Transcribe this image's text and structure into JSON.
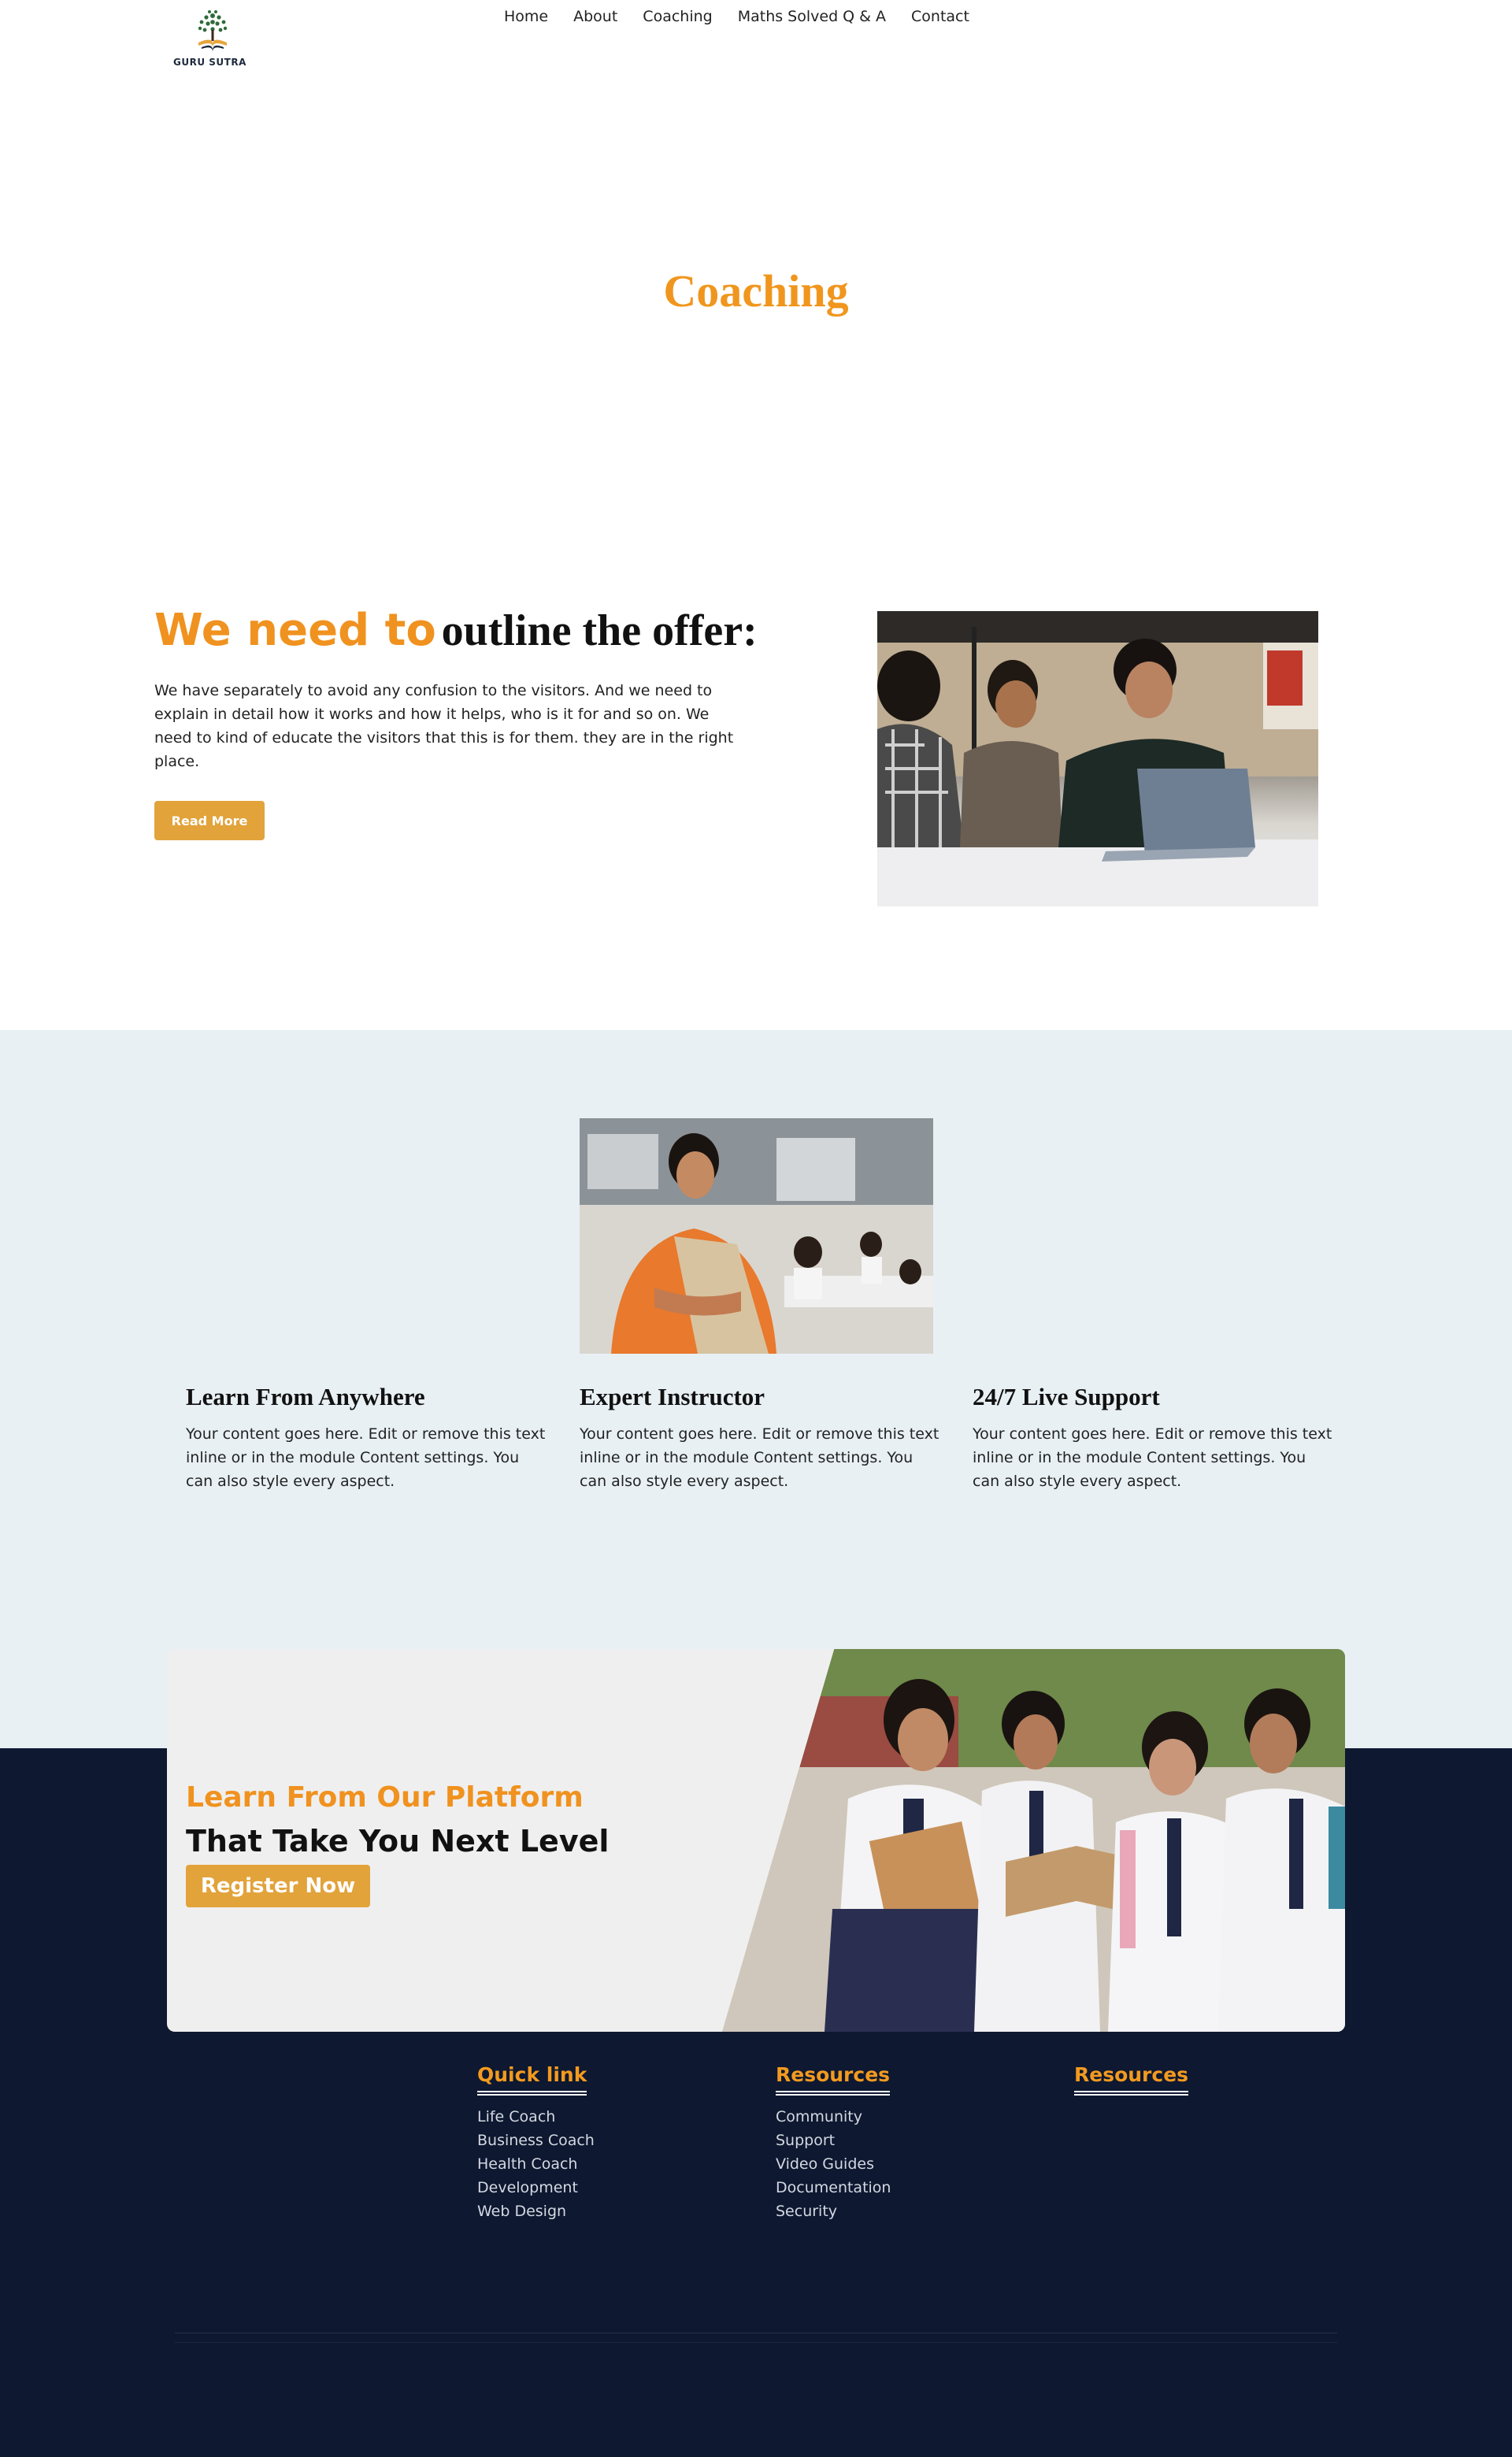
{
  "brand": {
    "name": "GURU SUTRA",
    "accent": "#f0921f",
    "button": "#e2a33b",
    "dark": "#0e1830",
    "light_band": "#e8f0f4"
  },
  "nav": {
    "items": [
      "Home",
      "About",
      "Coaching",
      "Maths Solved Q & A",
      "Contact"
    ]
  },
  "hero": {
    "title": "Coaching"
  },
  "offer": {
    "heading_accent": "We need to",
    "heading_rest": "outline the offer:",
    "body": "We have separately to avoid any confusion to the visitors. And we need to explain in detail how it works and how it helps, who is it for and so on. We need to kind of educate the visitors that this is for them. they are in the right place.",
    "button": "Read More"
  },
  "features": [
    {
      "title": "Learn From Anywhere",
      "text": "Your content goes here. Edit or remove this text inline or in the module Content settings. You can also style every aspect."
    },
    {
      "title": "Expert Instructor",
      "text": "Your content goes here. Edit or remove this text inline or in the module Content settings. You can also style every aspect."
    },
    {
      "title": "24/7 Live Support",
      "text": "Your content goes here. Edit or remove this text inline or in the module Content settings. You can also style every aspect."
    }
  ],
  "cta": {
    "line1": "Learn From Our Platform",
    "line2": "That Take You Next Level",
    "button": "Register Now"
  },
  "footer": {
    "columns": [
      {
        "title": "Quick link",
        "links": [
          "Life Coach",
          "Business Coach",
          "Health Coach",
          "Development",
          "Web Design"
        ]
      },
      {
        "title": "Resources",
        "links": [
          "Community",
          "Support",
          "Video Guides",
          "Documentation",
          "Security"
        ]
      },
      {
        "title": "Resources",
        "links": []
      }
    ]
  }
}
